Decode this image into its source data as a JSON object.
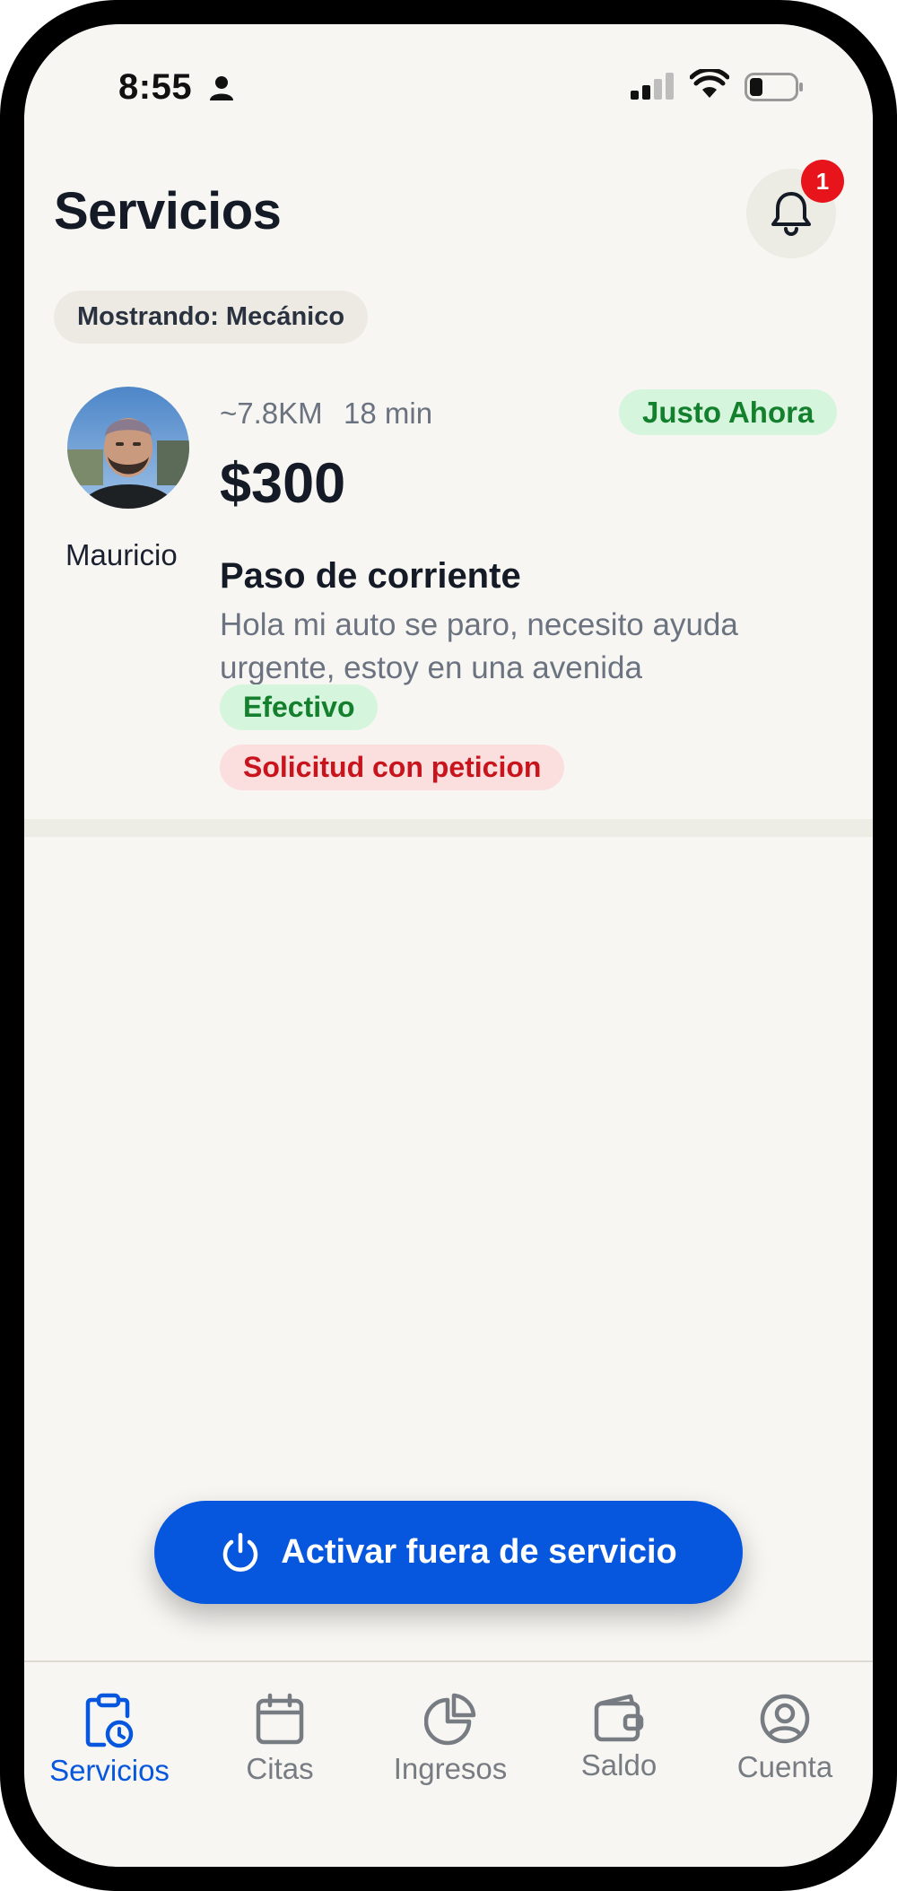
{
  "status_bar": {
    "time": "8:55"
  },
  "header": {
    "title": "Servicios",
    "notification_count": "1"
  },
  "filter": {
    "label": "Mostrando: Mecánico"
  },
  "service": {
    "client_name": "Mauricio",
    "distance": "~7.8KM",
    "eta": "18 min",
    "time_badge": "Justo Ahora",
    "price": "$300",
    "title": "Paso de corriente",
    "description": "Hola mi auto se paro, necesito ayuda urgente, estoy en una avenida",
    "payment_tag": "Efectivo",
    "request_tag": "Solicitud con peticion"
  },
  "offline_button": {
    "label": "Activar fuera de servicio"
  },
  "tabs": [
    {
      "label": "Servicios",
      "icon": "clipboard-clock-icon",
      "active": true
    },
    {
      "label": "Citas",
      "icon": "calendar-icon",
      "active": false
    },
    {
      "label": "Ingresos",
      "icon": "pie-chart-icon",
      "active": false
    },
    {
      "label": "Saldo",
      "icon": "wallet-icon",
      "active": false
    },
    {
      "label": "Cuenta",
      "icon": "user-circle-icon",
      "active": false
    }
  ],
  "colors": {
    "accent": "#0757de",
    "background": "#f7f6f2",
    "success": "#14802e",
    "danger": "#c8141c"
  }
}
